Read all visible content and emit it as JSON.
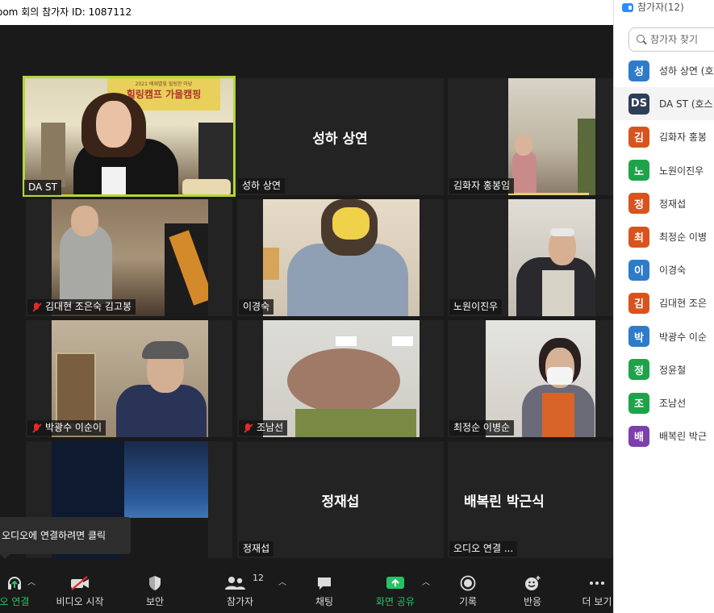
{
  "window": {
    "title": "oom 회의 참가자 ID: 1087112"
  },
  "tiles": [
    {
      "name": "DA ST",
      "big_name": "",
      "muted": false,
      "active": true
    },
    {
      "name": "성하 상연",
      "big_name": "성하 상연",
      "muted": false,
      "active": false
    },
    {
      "name": "김화자 홍봉임",
      "big_name": "",
      "muted": false,
      "active": false
    },
    {
      "name": "김대현 조은숙 김고봉",
      "big_name": "",
      "muted": true,
      "active": false
    },
    {
      "name": "이경숙",
      "big_name": "",
      "muted": false,
      "active": false
    },
    {
      "name": "노원이진우",
      "big_name": "",
      "muted": false,
      "active": false
    },
    {
      "name": "박광수 이순이",
      "big_name": "",
      "muted": true,
      "active": false
    },
    {
      "name": "조남선",
      "big_name": "",
      "muted": true,
      "active": false
    },
    {
      "name": "최정순 이병순",
      "big_name": "",
      "muted": false,
      "active": false
    },
    {
      "name": "",
      "big_name": "",
      "muted": false,
      "active": false
    },
    {
      "name": "정재섭",
      "big_name": "정재섭",
      "muted": false,
      "active": false
    },
    {
      "name": "오디오 연결 ...",
      "big_name": "배복린 박근식",
      "muted": false,
      "active": false
    }
  ],
  "banner_text": "힐링캠프 가을캠핑",
  "banner_small": "2021 배재별빛 힐링한 마당",
  "tooltip": "오디오에 연결하려면 클릭",
  "toolbar": {
    "audio": "오 연결",
    "video": "비디오 시작",
    "security": "보안",
    "participants": "참가자",
    "participants_count": "12",
    "chat": "채팅",
    "share": "화면 공유",
    "record": "기록",
    "reactions": "반응",
    "more": "더 보기"
  },
  "panel": {
    "title": "참가자(12)",
    "search_placeholder": "참가자 찾기",
    "participants": [
      {
        "initial": "성",
        "name": "성하 상연 (호",
        "color": "#2e7cc9"
      },
      {
        "initial": "DS",
        "name": "DA ST (호스",
        "color": "#2d3e57"
      },
      {
        "initial": "김",
        "name": "김화자 홍봉",
        "color": "#d9531e"
      },
      {
        "initial": "노",
        "name": "노원이진우",
        "color": "#1fa34a"
      },
      {
        "initial": "정",
        "name": "정재섭",
        "color": "#d9531e"
      },
      {
        "initial": "최",
        "name": "최정순 이병",
        "color": "#d9531e"
      },
      {
        "initial": "이",
        "name": "이경숙",
        "color": "#2e7cc9"
      },
      {
        "initial": "김",
        "name": "김대현 조은",
        "color": "#d9531e"
      },
      {
        "initial": "박",
        "name": "박광수 이순",
        "color": "#2e7cc9"
      },
      {
        "initial": "정",
        "name": "정윤철",
        "color": "#1fa34a"
      },
      {
        "initial": "조",
        "name": "조남선",
        "color": "#1fa34a"
      },
      {
        "initial": "배",
        "name": "배복린 박근",
        "color": "#7d3fae"
      }
    ]
  }
}
